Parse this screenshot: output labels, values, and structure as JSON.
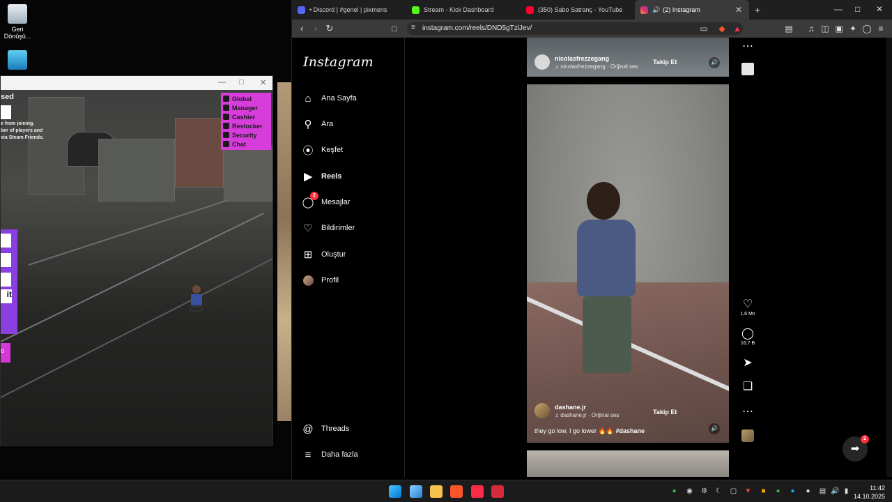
{
  "desktop": {
    "icons": [
      {
        "name": "recycle-bin",
        "label": "Geri\nDönüşü..."
      },
      {
        "name": "this-pc",
        "label": ""
      }
    ]
  },
  "game": {
    "top_text": "sed",
    "small_text": "e from joining.\nber of players and\nvia Steam Friends.",
    "purple_panel_text": "it",
    "magenta_text": "o",
    "roles": [
      "Global",
      "Manager",
      "Cashier",
      "Restocker",
      "Security",
      "Chat"
    ]
  },
  "browser": {
    "tabs": [
      {
        "title": "• Discord | #genel | pixmens",
        "color": "#5865f2"
      },
      {
        "title": "Stream - Kick Dashboard",
        "color": "#53fc18"
      },
      {
        "title": "(350) Sabo Satranç - YouTube",
        "color": "#ff0033"
      },
      {
        "title": "(2) Instagram",
        "color": "#e1306c",
        "active": true
      }
    ],
    "url": "instagram.com/reels/DND5gTzlJev/"
  },
  "instagram": {
    "logo": "Instagram",
    "nav": [
      {
        "label": "Ana Sayfa",
        "icon": "home-icon"
      },
      {
        "label": "Ara",
        "icon": "search-icon"
      },
      {
        "label": "Keşfet",
        "icon": "compass-icon"
      },
      {
        "label": "Reels",
        "icon": "reels-icon"
      },
      {
        "label": "Mesajlar",
        "icon": "messenger-icon",
        "badge": "2"
      },
      {
        "label": "Bildirimler",
        "icon": "heart-icon"
      },
      {
        "label": "Oluştur",
        "icon": "plus-icon"
      },
      {
        "label": "Profil",
        "icon": "avatar-icon"
      }
    ],
    "threads": "Threads",
    "more": "Daha fazla",
    "prev_reel": {
      "username": "nicolasfrezzegang",
      "audio": "nicolasfrezzegang · Orijinal ses",
      "follow": "Takip Et"
    },
    "reel": {
      "username": "dashane.jr",
      "audio": "dashane.jr · Orijinal ses",
      "follow": "Takip Et",
      "caption": "they go low, I go lower",
      "emoji": "🔥🔥",
      "hashtag": "#dashane",
      "likes": "1,6 Mn",
      "comments": "16,7 B"
    },
    "fab_badge": "2"
  },
  "taskbar": {
    "time": "11:42",
    "date": "14.10.2025"
  }
}
